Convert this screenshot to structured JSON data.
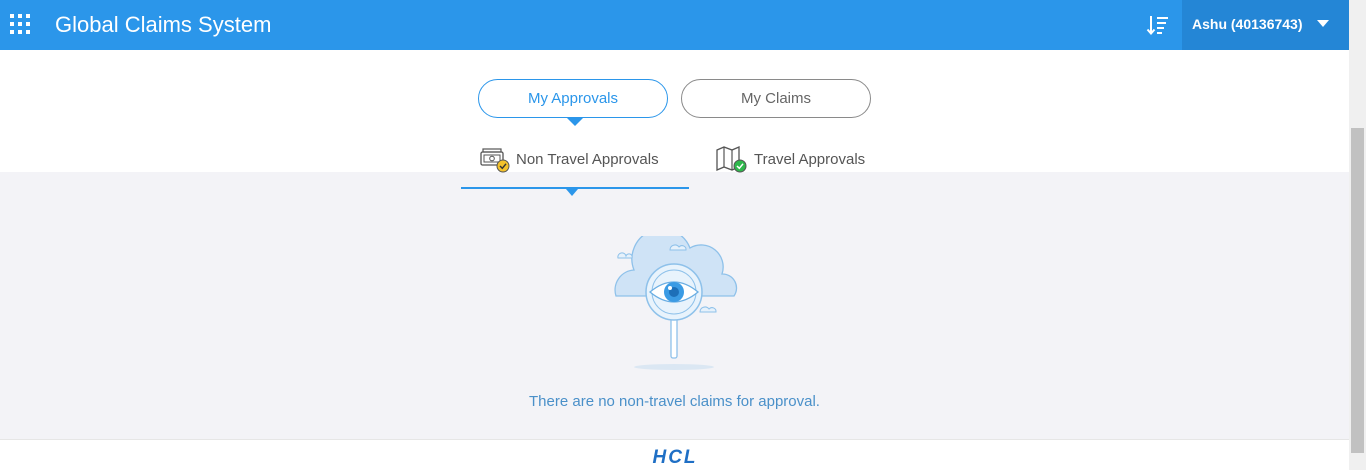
{
  "header": {
    "title": "Global Claims System",
    "apps_icon": "apps-grid-icon",
    "sort_icon": "sort-list-icon",
    "user": "Ashu (40136743)",
    "user_menu_icon": "caret-down-icon",
    "background_color": "#2b96ea"
  },
  "main_tabs": [
    {
      "label": "My Approvals",
      "active": true
    },
    {
      "label": "My Claims",
      "active": false
    }
  ],
  "sub_tabs": [
    {
      "label": "Non Travel Approvals",
      "icon": "money-check-icon",
      "active": true
    },
    {
      "label": "Travel Approvals",
      "icon": "map-check-icon",
      "active": false
    }
  ],
  "empty_state": {
    "illustration": "cloud-magnifier-eye-icon",
    "message": "There are no non-travel claims for approval."
  },
  "footer": {
    "logo_text": "HCL"
  },
  "colors": {
    "accent": "#2b96ea",
    "content_background": "#f3f3f7",
    "message_text": "#4a90c9"
  }
}
